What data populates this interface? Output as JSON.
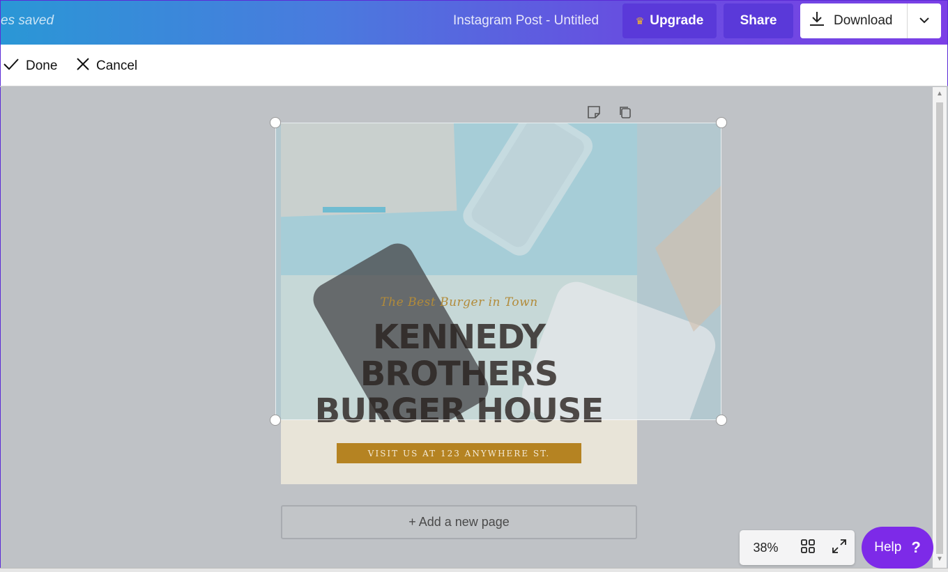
{
  "topbar": {
    "saved_text": "es saved",
    "doc_title": "Instagram Post - Untitled",
    "upgrade_label": "Upgrade",
    "share_label": "Share",
    "download_label": "Download"
  },
  "actionbar": {
    "done_label": "Done",
    "cancel_label": "Cancel"
  },
  "design": {
    "tagline": "The Best Burger in Town",
    "headline_line1": "KENNEDY",
    "headline_line2": "BROTHERS",
    "headline_line3": "BURGER HOUSE",
    "visit_text": "VISIT US AT 123 ANYWHERE ST."
  },
  "add_page_label": "+ Add a new page",
  "zoom": {
    "value": "38%"
  },
  "help": {
    "label": "Help",
    "glyph": "?"
  },
  "colors": {
    "accent": "#7d2ae8",
    "gold": "#b58322",
    "upgrade_bg": "#5a39d9"
  }
}
